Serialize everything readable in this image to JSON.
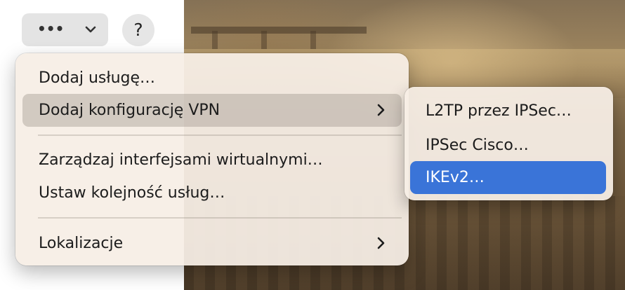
{
  "toolbar": {
    "action_label": "•••",
    "action_icon": "ellipsis-icon",
    "dropdown_icon": "chevron-down-icon",
    "help_label": "?"
  },
  "menu": {
    "items": [
      {
        "label": "Dodaj usługę…",
        "has_submenu": false
      },
      {
        "label": "Dodaj konfigurację VPN",
        "has_submenu": true,
        "highlighted": true
      },
      {
        "label": "Zarządzaj interfejsami wirtualnymi…",
        "has_submenu": false
      },
      {
        "label": "Ustaw kolejność usług…",
        "has_submenu": false
      },
      {
        "label": "Lokalizacje",
        "has_submenu": true
      }
    ]
  },
  "submenu": {
    "items": [
      {
        "label": "L2TP przez IPSec…"
      },
      {
        "label": "IPSec Cisco…"
      },
      {
        "label": "IKEv2…",
        "selected": true
      }
    ]
  },
  "colors": {
    "selection": "#3a74d8",
    "menu_bg": "#f6eee6"
  }
}
